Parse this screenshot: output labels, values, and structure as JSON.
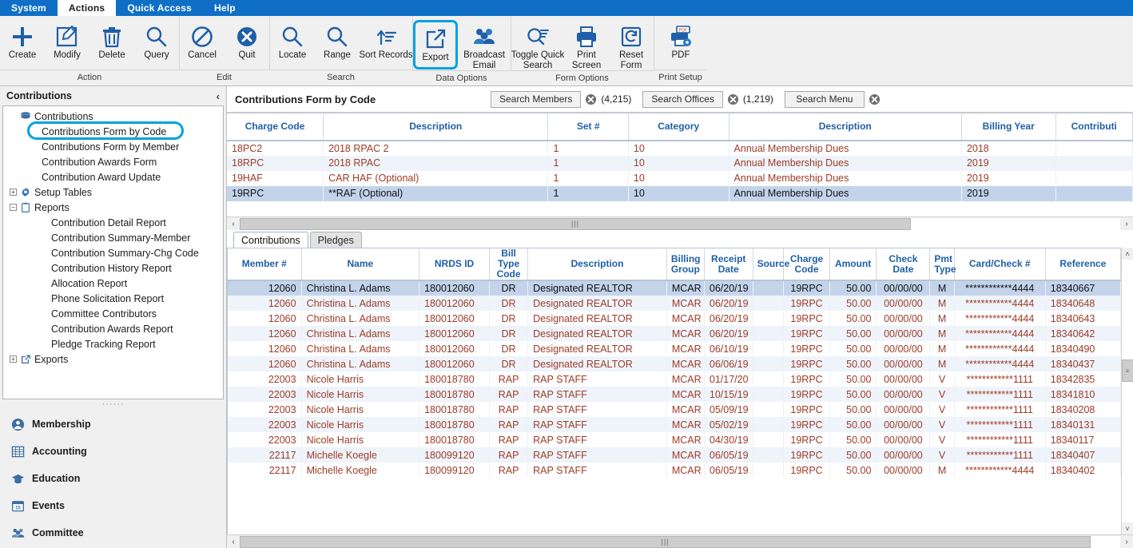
{
  "menubar": {
    "items": [
      {
        "label": "System",
        "active": false
      },
      {
        "label": "Actions",
        "active": true
      },
      {
        "label": "Quick Access",
        "active": false
      },
      {
        "label": "Help",
        "active": false
      }
    ]
  },
  "ribbon": {
    "groups": [
      {
        "label": "Action",
        "buttons": [
          {
            "label": "Create",
            "icon": "plus-icon"
          },
          {
            "label": "Modify",
            "icon": "pencil-square-icon"
          },
          {
            "label": "Delete",
            "icon": "trash-icon"
          },
          {
            "label": "Query",
            "icon": "magnifier-icon"
          }
        ]
      },
      {
        "label": "Edit",
        "buttons": [
          {
            "label": "Cancel",
            "icon": "no-entry-icon"
          },
          {
            "label": "Quit",
            "icon": "x-circle-icon"
          }
        ]
      },
      {
        "label": "Search",
        "buttons": [
          {
            "label": "Locate",
            "icon": "magnifier-icon"
          },
          {
            "label": "Range",
            "icon": "magnifier-icon"
          },
          {
            "label": "Sort Records",
            "icon": "sort-icon"
          }
        ]
      },
      {
        "label": "Data Options",
        "buttons": [
          {
            "label": "Export",
            "icon": "export-icon",
            "highlighted": true
          },
          {
            "label": "Broadcast Email",
            "icon": "people-icon"
          }
        ]
      },
      {
        "label": "Form Options",
        "buttons": [
          {
            "label": "Toggle Quick Search",
            "icon": "magnifier-list-icon"
          },
          {
            "label": "Print Screen",
            "icon": "printer-icon"
          },
          {
            "label": "Reset Form",
            "icon": "refresh-icon"
          }
        ]
      },
      {
        "label": "Print Setup",
        "buttons": [
          {
            "label": "PDF",
            "icon": "pdf-icon"
          }
        ]
      }
    ]
  },
  "sidebar": {
    "title": "Contributions",
    "collapse_glyph": "‹",
    "tree": [
      {
        "label": "Contributions",
        "level": 1,
        "icon": "database-icon",
        "expander": "",
        "highlight": false
      },
      {
        "label": "Contributions Form by Code",
        "level": 2,
        "icon": "",
        "expander": "",
        "highlight": true
      },
      {
        "label": "Contributions Form by Member",
        "level": 2,
        "icon": "",
        "expander": "",
        "highlight": false
      },
      {
        "label": "Contribution Awards Form",
        "level": 2,
        "icon": "",
        "expander": "",
        "highlight": false
      },
      {
        "label": "Contribution Award Update",
        "level": 2,
        "icon": "",
        "expander": "",
        "highlight": false
      },
      {
        "label": "Setup Tables",
        "level": 1,
        "icon": "gear-icon",
        "expander": "+",
        "highlight": false
      },
      {
        "label": "Reports",
        "level": 1,
        "icon": "report-icon",
        "expander": "−",
        "highlight": false
      },
      {
        "label": "Contribution Detail Report",
        "level": 3,
        "icon": "",
        "expander": "",
        "highlight": false
      },
      {
        "label": "Contribution Summary-Member",
        "level": 3,
        "icon": "",
        "expander": "",
        "highlight": false
      },
      {
        "label": "Contribution Summary-Chg Code",
        "level": 3,
        "icon": "",
        "expander": "",
        "highlight": false
      },
      {
        "label": "Contribution History Report",
        "level": 3,
        "icon": "",
        "expander": "",
        "highlight": false
      },
      {
        "label": "Allocation Report",
        "level": 3,
        "icon": "",
        "expander": "",
        "highlight": false
      },
      {
        "label": "Phone Solicitation Report",
        "level": 3,
        "icon": "",
        "expander": "",
        "highlight": false
      },
      {
        "label": "Committee Contributors",
        "level": 3,
        "icon": "",
        "expander": "",
        "highlight": false
      },
      {
        "label": "Contribution Awards Report",
        "level": 3,
        "icon": "",
        "expander": "",
        "highlight": false
      },
      {
        "label": "Pledge Tracking Report",
        "level": 3,
        "icon": "",
        "expander": "",
        "highlight": false
      },
      {
        "label": "Exports",
        "level": 1,
        "icon": "export-icon",
        "expander": "+",
        "highlight": false
      }
    ],
    "splitter_dots": "······",
    "nav": [
      {
        "label": "Membership",
        "icon": "person-circle-icon"
      },
      {
        "label": "Accounting",
        "icon": "spreadsheet-icon"
      },
      {
        "label": "Education",
        "icon": "graduation-cap-icon"
      },
      {
        "label": "Events",
        "icon": "calendar-icon"
      },
      {
        "label": "Committee",
        "icon": "people-icon"
      }
    ]
  },
  "content_header": {
    "title": "Contributions Form by Code",
    "search_buttons": [
      {
        "label": "Search Members",
        "count": "(4,215)",
        "clear_icon": "x-circle-icon"
      },
      {
        "label": "Search Offices",
        "count": "(1,219)",
        "clear_icon": "x-circle-icon"
      },
      {
        "label": "Search Menu",
        "count": "",
        "clear_icon": "x-circle-icon"
      }
    ]
  },
  "top_grid": {
    "columns": [
      "Charge Code",
      "Description",
      "Set #",
      "Category",
      "Description",
      "Billing Year",
      "Contributi"
    ],
    "rows": [
      {
        "cells": [
          "18PC2",
          "2018 RPAC 2",
          "1",
          "10",
          "Annual Membership Dues",
          "2018",
          ""
        ],
        "selected": false
      },
      {
        "cells": [
          "18RPC",
          "2018 RPAC",
          "1",
          "10",
          "Annual Membership Dues",
          "2019",
          ""
        ],
        "selected": false
      },
      {
        "cells": [
          "19HAF",
          "CAR HAF  (Optional)",
          "1",
          "10",
          "Annual Membership Dues",
          "2019",
          ""
        ],
        "selected": false
      },
      {
        "cells": [
          "19RPC",
          "**RAF (Optional)",
          "1",
          "10",
          "Annual Membership Dues",
          "2019",
          ""
        ],
        "selected": true
      }
    ],
    "hscroll": {
      "left_arrow": "‹",
      "right_arrow": "›",
      "grip": "|||"
    }
  },
  "tabs": [
    {
      "label": "Contributions",
      "active": true
    },
    {
      "label": "Pledges",
      "active": false
    }
  ],
  "bottom_grid": {
    "columns": [
      "Member #",
      "Name",
      "NRDS ID",
      "Bill Type Code",
      "Description",
      "Billing Group",
      "Receipt Date",
      "Source",
      "Charge Code",
      "Amount",
      "Check Date",
      "Pmt Type",
      "Card/Check #",
      "Reference"
    ],
    "rows": [
      {
        "selected": true,
        "cells": [
          "12060",
          "Christina L. Adams",
          "180012060",
          "DR",
          "Designated REALTOR",
          "MCAR",
          "06/20/19",
          "",
          "19RPC",
          "50.00",
          "00/00/00",
          "M",
          "************4444",
          "18340667"
        ]
      },
      {
        "selected": false,
        "cells": [
          "12060",
          "Christina L. Adams",
          "180012060",
          "DR",
          "Designated REALTOR",
          "MCAR",
          "06/20/19",
          "",
          "19RPC",
          "50.00",
          "00/00/00",
          "M",
          "************4444",
          "18340648"
        ]
      },
      {
        "selected": false,
        "cells": [
          "12060",
          "Christina L. Adams",
          "180012060",
          "DR",
          "Designated REALTOR",
          "MCAR",
          "06/20/19",
          "",
          "19RPC",
          "50.00",
          "00/00/00",
          "M",
          "************4444",
          "18340643"
        ]
      },
      {
        "selected": false,
        "cells": [
          "12060",
          "Christina L. Adams",
          "180012060",
          "DR",
          "Designated REALTOR",
          "MCAR",
          "06/20/19",
          "",
          "19RPC",
          "50.00",
          "00/00/00",
          "M",
          "************4444",
          "18340642"
        ]
      },
      {
        "selected": false,
        "cells": [
          "12060",
          "Christina L. Adams",
          "180012060",
          "DR",
          "Designated REALTOR",
          "MCAR",
          "06/10/19",
          "",
          "19RPC",
          "50.00",
          "00/00/00",
          "M",
          "************4444",
          "18340490"
        ]
      },
      {
        "selected": false,
        "cells": [
          "12060",
          "Christina L. Adams",
          "180012060",
          "DR",
          "Designated REALTOR",
          "MCAR",
          "06/06/19",
          "",
          "19RPC",
          "50.00",
          "00/00/00",
          "M",
          "************4444",
          "18340437"
        ]
      },
      {
        "selected": false,
        "cells": [
          "22003",
          "Nicole Harris",
          "180018780",
          "RAP",
          "RAP STAFF",
          "MCAR",
          "01/17/20",
          "",
          "19RPC",
          "50.00",
          "00/00/00",
          "V",
          "************1111",
          "18342835"
        ]
      },
      {
        "selected": false,
        "cells": [
          "22003",
          "Nicole Harris",
          "180018780",
          "RAP",
          "RAP STAFF",
          "MCAR",
          "10/15/19",
          "",
          "19RPC",
          "50.00",
          "00/00/00",
          "V",
          "************1111",
          "18341810"
        ]
      },
      {
        "selected": false,
        "cells": [
          "22003",
          "Nicole Harris",
          "180018780",
          "RAP",
          "RAP STAFF",
          "MCAR",
          "05/09/19",
          "",
          "19RPC",
          "50.00",
          "00/00/00",
          "V",
          "************1111",
          "18340208"
        ]
      },
      {
        "selected": false,
        "cells": [
          "22003",
          "Nicole Harris",
          "180018780",
          "RAP",
          "RAP STAFF",
          "MCAR",
          "05/02/19",
          "",
          "19RPC",
          "50.00",
          "00/00/00",
          "V",
          "************1111",
          "18340131"
        ]
      },
      {
        "selected": false,
        "cells": [
          "22003",
          "Nicole Harris",
          "180018780",
          "RAP",
          "RAP STAFF",
          "MCAR",
          "04/30/19",
          "",
          "19RPC",
          "50.00",
          "00/00/00",
          "V",
          "************1111",
          "18340117"
        ]
      },
      {
        "selected": false,
        "cells": [
          "22117",
          "Michelle Koegle",
          "180099120",
          "RAP",
          "RAP STAFF",
          "MCAR",
          "06/05/19",
          "",
          "19RPC",
          "50.00",
          "00/00/00",
          "V",
          "************1111",
          "18340407"
        ]
      },
      {
        "selected": false,
        "cells": [
          "22117",
          "Michelle Koegle",
          "180099120",
          "RAP",
          "RAP STAFF",
          "MCAR",
          "06/05/19",
          "",
          "19RPC",
          "50.00",
          "00/00/00",
          "M",
          "************4444",
          "18340402"
        ]
      }
    ],
    "hscroll": {
      "left_arrow": "‹",
      "right_arrow": "›",
      "grip": "|||"
    },
    "vscroll": {
      "up_arrow": "˄",
      "down_arrow": "˅",
      "grip": "≡"
    }
  },
  "colors": {
    "menu_blue": "#0f6fc6",
    "highlight_cyan": "#00a2e0",
    "header_text": "#1f5fa8",
    "data_red": "#9e3b28",
    "selection_blue": "#c3d4ea"
  }
}
